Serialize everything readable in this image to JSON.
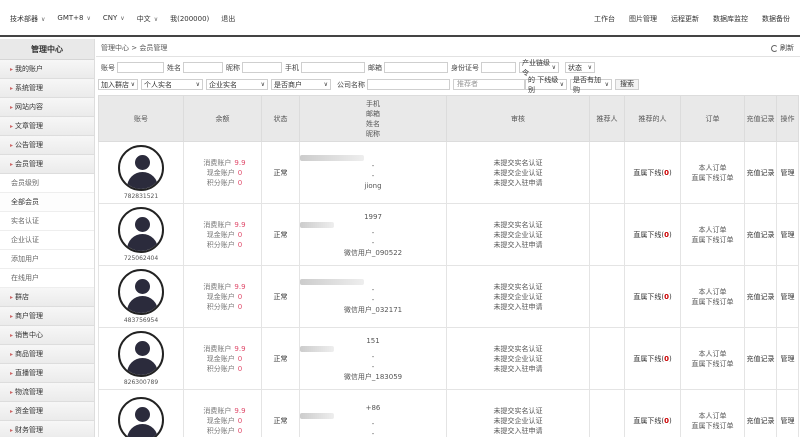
{
  "topbar": {
    "left": [
      {
        "label": "技术部器",
        "chev": true
      },
      {
        "label": "GMT+8",
        "chev": true
      },
      {
        "label": "CNY",
        "chev": true
      },
      {
        "label": "中文",
        "chev": true
      },
      {
        "label": "我(200000)",
        "chev": false
      },
      {
        "label": "退出",
        "chev": false
      }
    ],
    "right": [
      "工作台",
      "图片管理",
      "远程更新",
      "数据库监控",
      "数据备份"
    ]
  },
  "sidebar": {
    "title": "管理中心",
    "items": [
      {
        "label": "我的账户",
        "type": "group"
      },
      {
        "label": "系统管理",
        "type": "group"
      },
      {
        "label": "网站内容",
        "type": "group"
      },
      {
        "label": "文章管理",
        "type": "group"
      },
      {
        "label": "公告管理",
        "type": "group"
      },
      {
        "label": "会员管理",
        "type": "group"
      },
      {
        "label": "会员级别",
        "type": "sub"
      },
      {
        "label": "全部会员",
        "type": "sub",
        "active": true
      },
      {
        "label": "实名认证",
        "type": "sub"
      },
      {
        "label": "企业认证",
        "type": "sub"
      },
      {
        "label": "添加用户",
        "type": "sub"
      },
      {
        "label": "在线用户",
        "type": "sub"
      },
      {
        "label": "群店",
        "type": "group"
      },
      {
        "label": "商户管理",
        "type": "group"
      },
      {
        "label": "销售中心",
        "type": "group"
      },
      {
        "label": "商品管理",
        "type": "group"
      },
      {
        "label": "直播管理",
        "type": "group"
      },
      {
        "label": "物流管理",
        "type": "group"
      },
      {
        "label": "资金管理",
        "type": "group"
      },
      {
        "label": "财务管理",
        "type": "group"
      }
    ]
  },
  "breadcrumb": "管理中心 > 会员管理",
  "refresh_label": "刷新",
  "filters": {
    "row1": [
      {
        "kind": "input",
        "label": "账号",
        "w": 47
      },
      {
        "kind": "input",
        "label": "姓名",
        "w": 40
      },
      {
        "kind": "input",
        "label": "昵称",
        "w": 40
      },
      {
        "kind": "input",
        "label": "手机",
        "w": 64
      },
      {
        "kind": "input",
        "label": "邮箱",
        "w": 64
      },
      {
        "kind": "input",
        "label": "身份证号",
        "w": 35
      },
      {
        "kind": "select",
        "label": "产业链级令",
        "w": 40
      },
      {
        "kind": "select",
        "label": "状态",
        "w": 30
      }
    ],
    "row2_selects": [
      {
        "label": "加入群店",
        "w": 40
      },
      {
        "label": "个人实名",
        "w": 62
      },
      {
        "label": "企业实名",
        "w": 62
      },
      {
        "label": "是否商户",
        "w": 60
      }
    ],
    "row2_company_label": "公司名称",
    "row2_referrer_placeholder": "推荐者",
    "row2_downline_label": "的 下线级别",
    "row2_merchant_select": "是否有加购",
    "search_button": "搜索"
  },
  "table": {
    "headers": {
      "account": "账号",
      "balance": "余额",
      "status": "状态",
      "contact": [
        "手机",
        "邮箱",
        "姓名",
        "昵称"
      ],
      "audit": "审核",
      "referrer": "推荐人",
      "referred": "推荐的人",
      "orders": "订单",
      "recharge": "充值记录",
      "ops": "操作"
    },
    "rows": [
      {
        "id": "782831521",
        "consume_label": "消费账户",
        "consume": "9.9",
        "cash_label": "现金账户",
        "cash": "0",
        "points_label": "积分账户",
        "points": "0",
        "status": "正常",
        "phone": "",
        "email": "-",
        "name": "-",
        "nick": "jiong",
        "audit": [
          "未提交实名认证",
          "未提交企业认证",
          "未提交入驻申请"
        ],
        "referred_label": "直属下线",
        "referred": "0",
        "orders": [
          "本人订单",
          "直属下线订单"
        ],
        "recharge": "充值记录",
        "ops": "管理"
      },
      {
        "id": "725062404",
        "consume_label": "消费账户",
        "consume": "9.9",
        "cash_label": "现金账户",
        "cash": "0",
        "points_label": "积分账户",
        "points": "0",
        "status": "正常",
        "phone": "1997",
        "email": "-",
        "name": "-",
        "nick": "微信用户_090522",
        "audit": [
          "未提交实名认证",
          "未提交企业认证",
          "未提交入驻申请"
        ],
        "referred_label": "直属下线",
        "referred": "0",
        "orders": [
          "本人订单",
          "直属下线订单"
        ],
        "recharge": "充值记录",
        "ops": "管理"
      },
      {
        "id": "483756954",
        "consume_label": "消费账户",
        "consume": "9.9",
        "cash_label": "现金账户",
        "cash": "0",
        "points_label": "积分账户",
        "points": "0",
        "status": "正常",
        "phone": "",
        "email": "-",
        "name": "-",
        "nick": "微信用户_032171",
        "audit": [
          "未提交实名认证",
          "未提交企业认证",
          "未提交入驻申请"
        ],
        "referred_label": "直属下线",
        "referred": "0",
        "orders": [
          "本人订单",
          "直属下线订单"
        ],
        "recharge": "充值记录",
        "ops": "管理"
      },
      {
        "id": "826300789",
        "consume_label": "消费账户",
        "consume": "9.9",
        "cash_label": "现金账户",
        "cash": "0",
        "points_label": "积分账户",
        "points": "0",
        "status": "正常",
        "phone": "151",
        "email": "-",
        "name": "-",
        "nick": "微信用户_183059",
        "audit": [
          "未提交实名认证",
          "未提交企业认证",
          "未提交入驻申请"
        ],
        "referred_label": "直属下线",
        "referred": "0",
        "orders": [
          "本人订单",
          "直属下线订单"
        ],
        "recharge": "充值记录",
        "ops": "管理"
      },
      {
        "id": "",
        "consume_label": "消费账户",
        "consume": "9.9",
        "cash_label": "现金账户",
        "cash": "0",
        "points_label": "积分账户",
        "points": "0",
        "status": "正常",
        "phone": "+86",
        "email": "-",
        "name": "-",
        "nick": "",
        "audit": [
          "未提交实名认证",
          "未提交企业认证",
          "未提交入驻申请"
        ],
        "referred_label": "直属下线",
        "referred": "0",
        "orders": [
          "本人订单",
          "直属下线订单"
        ],
        "recharge": "充值记录",
        "ops": "管理"
      }
    ]
  }
}
